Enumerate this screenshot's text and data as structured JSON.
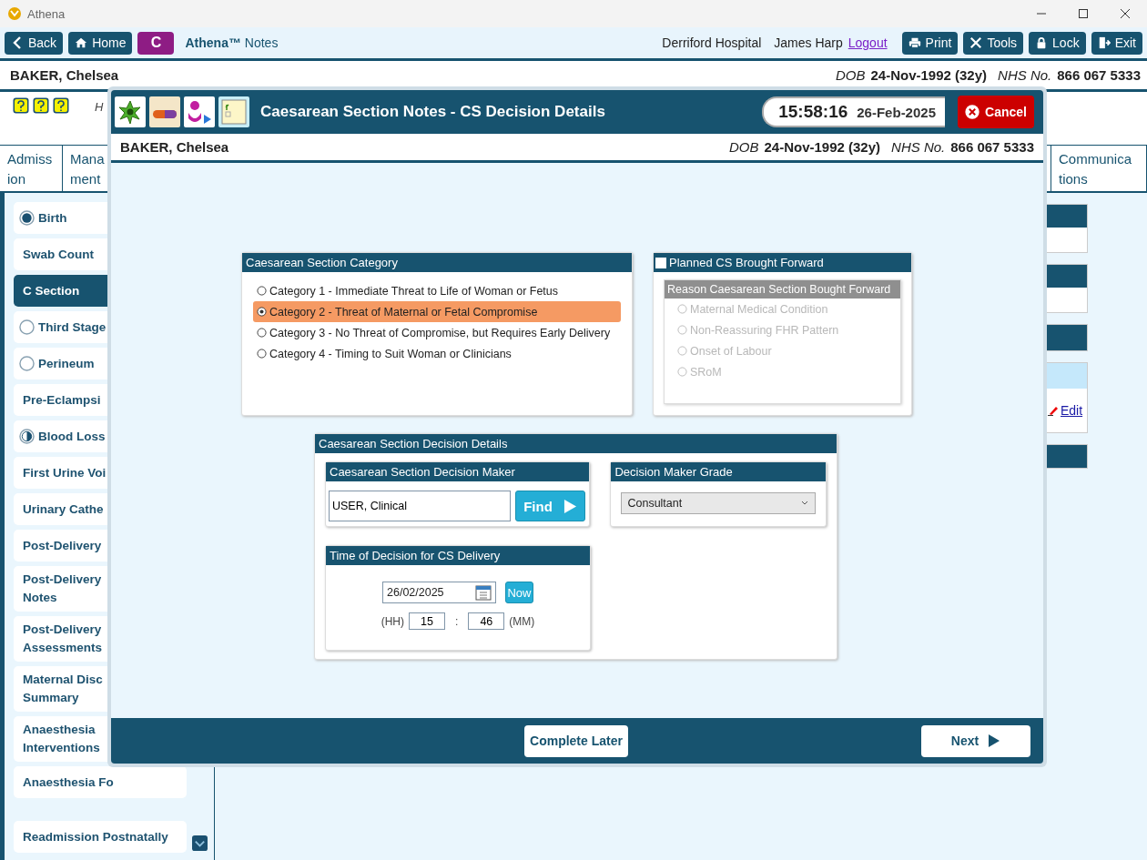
{
  "window": {
    "title": "Athena"
  },
  "toolbar": {
    "back": "Back",
    "home": "Home",
    "badge": "C",
    "app_name": "Athena™",
    "app_suffix": "Notes",
    "hospital": "Derriford Hospital",
    "user": "James Harp",
    "logout": "Logout",
    "buttons": [
      {
        "label": "Print",
        "kind": "print"
      },
      {
        "label": "Tools",
        "kind": "tools"
      },
      {
        "label": "Lock",
        "kind": "lock"
      },
      {
        "label": "Exit",
        "kind": "exit"
      }
    ]
  },
  "patient": {
    "name": "BAKER, Chelsea",
    "dob_label": "DOB",
    "dob": "24-Nov-1992 (32y)",
    "nhs_label": "NHS No.",
    "nhs": "866 067 5333"
  },
  "header_note": "H",
  "tabs": [
    {
      "lines": [
        "Admiss",
        "ion"
      ]
    },
    {
      "lines": [
        "Mana",
        "ment"
      ]
    },
    {
      "lines": [
        "Communica",
        "tions"
      ]
    }
  ],
  "sidebar": {
    "items": [
      {
        "label": "Birth",
        "kind": "complete",
        "selected": false
      },
      {
        "label": "Swab Count",
        "kind": "plain",
        "selected": false
      },
      {
        "label": "C Section",
        "kind": "plain",
        "selected": true
      },
      {
        "label": "Third Stage",
        "kind": "empty",
        "selected": false
      },
      {
        "label": "Perineum",
        "kind": "empty",
        "selected": false
      },
      {
        "label": "Pre-Eclampsi",
        "kind": "plain",
        "selected": false
      },
      {
        "label": "Blood Loss",
        "kind": "partial",
        "selected": false
      },
      {
        "label": "First Urine Voi",
        "kind": "plain",
        "selected": false
      },
      {
        "label": "Urinary Cathe",
        "kind": "plain",
        "selected": false
      },
      {
        "label": "Post-Delivery",
        "kind": "plain",
        "selected": false
      },
      {
        "label": "Post-Delivery Notes",
        "kind": "plain",
        "selected": false
      },
      {
        "label": "Post-Delivery Assessments",
        "kind": "plain",
        "selected": false
      },
      {
        "label": "Maternal Disc Summary",
        "kind": "plain",
        "selected": false
      },
      {
        "label": "Anaesthesia Interventions",
        "kind": "plain",
        "selected": false
      },
      {
        "label": "Anaesthesia Fo",
        "kind": "plain",
        "selected": false
      },
      {
        "label": "Readmission Postnatally",
        "kind": "plain",
        "selected": false
      }
    ]
  },
  "right_panels": {
    "edit": "Edit"
  },
  "modal": {
    "title": "Caesarean Section Notes - CS Decision Details",
    "time": "15:58:16",
    "date": "26-Feb-2025",
    "cancel": "Cancel",
    "patient": {
      "name": "BAKER, Chelsea",
      "dob_label": "DOB",
      "dob": "24-Nov-1992 (32y)",
      "nhs_label": "NHS No.",
      "nhs": "866 067 5333"
    },
    "category": {
      "title": "Caesarean Section Category",
      "options": [
        {
          "label": "Category 1 - Immediate Threat to Life of Woman or Fetus",
          "selected": false
        },
        {
          "label": "Category 2 - Threat of Maternal or Fetal Compromise",
          "selected": true
        },
        {
          "label": "Category 3 - No Threat of Compromise, but Requires Early Delivery",
          "selected": false
        },
        {
          "label": "Category 4 - Timing to Suit Woman or Clinicians",
          "selected": false
        }
      ]
    },
    "planned": {
      "label": "Planned CS Brought Forward",
      "checked": false,
      "reason": {
        "title": "Reason Caesarean Section Bought Forward",
        "disabled": true,
        "options": [
          {
            "label": "Maternal Medical Condition",
            "selected": false
          },
          {
            "label": "Non-Reassuring FHR Pattern",
            "selected": false
          },
          {
            "label": "Onset of Labour",
            "selected": false
          },
          {
            "label": "SRoM",
            "selected": false
          }
        ]
      }
    },
    "decision": {
      "title": "Caesarean Section Decision Details",
      "maker": {
        "title": "Caesarean Section Decision Maker",
        "value": "USER, Clinical",
        "find": "Find"
      },
      "grade": {
        "title": "Decision Maker Grade",
        "value": "Consultant"
      },
      "time": {
        "title": "Time of Decision for CS Delivery",
        "date": "26/02/2025",
        "now": "Now",
        "hh_label": "(HH)",
        "hh": "15",
        "sep": ":",
        "mm": "46",
        "mm_label": "(MM)"
      }
    },
    "footer": {
      "complete_later": "Complete Later",
      "next": "Next"
    }
  }
}
